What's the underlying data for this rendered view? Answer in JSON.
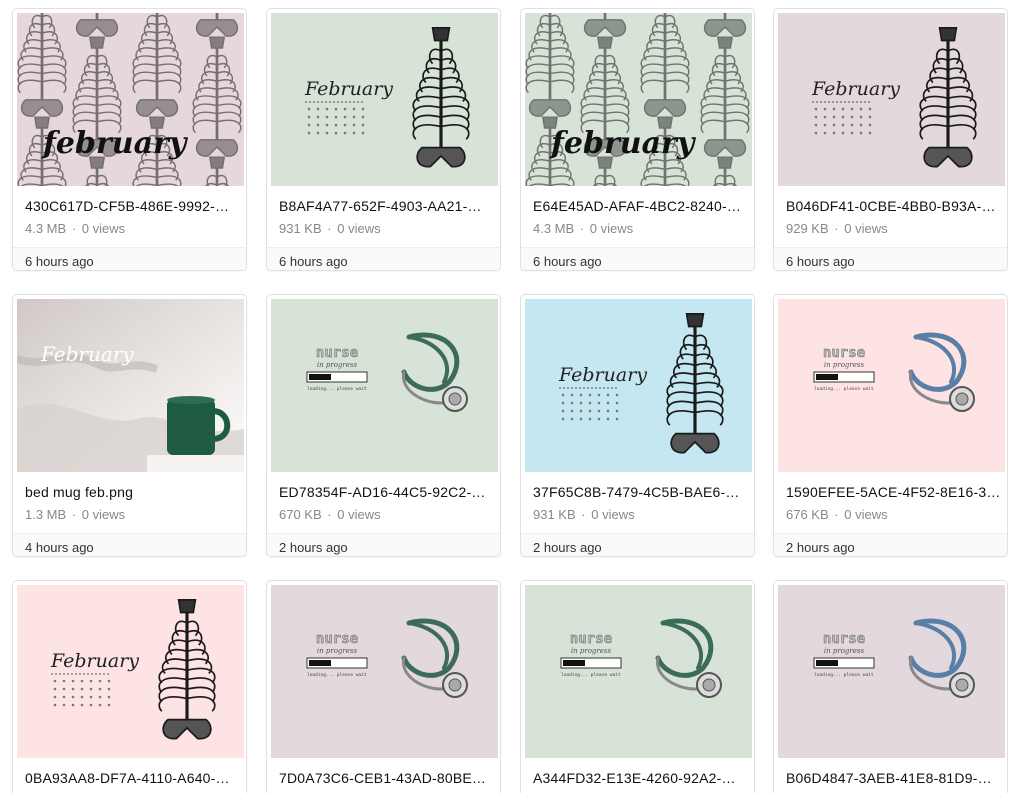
{
  "views_label": "views",
  "colors": {
    "pink": "#e6d7df",
    "green": "#d6e3d6",
    "mauve": "#e3d8de",
    "blue": "#c5e7f2",
    "rose": "#fde3e4"
  },
  "cards": [
    {
      "name": "430C617D-CF5B-486E-9992-…",
      "size": "4.3 MB",
      "views": "0",
      "time": "6 hours ago",
      "thumb": "skeleton-pattern",
      "thumb_text": "february"
    },
    {
      "name": "B8AF4A77-652F-4903-AA21-…",
      "size": "931 KB",
      "views": "0",
      "time": "6 hours ago",
      "thumb": "calendar-ribcage",
      "thumb_text": "February"
    },
    {
      "name": "E64E45AD-AFAF-4BC2-8240-…",
      "size": "4.3 MB",
      "views": "0",
      "time": "6 hours ago",
      "thumb": "skeleton-pattern",
      "thumb_text": "february"
    },
    {
      "name": "B046DF41-0CBE-4BB0-B93A-…",
      "size": "929 KB",
      "views": "0",
      "time": "6 hours ago",
      "thumb": "calendar-ribcage",
      "thumb_text": "February"
    },
    {
      "name": "bed mug feb.png",
      "size": "1.3 MB",
      "views": "0",
      "time": "4 hours ago",
      "thumb": "bed-mug-photo",
      "thumb_text": "February"
    },
    {
      "name": "ED78354F-AD16-44C5-92C2-…",
      "size": "670 KB",
      "views": "0",
      "time": "2 hours ago",
      "thumb": "nurse-stethoscope",
      "thumb_text": "nurse",
      "thumb_sub": "in progress",
      "thumb_note": "loading... please wait"
    },
    {
      "name": "37F65C8B-7479-4C5B-BAE6-…",
      "size": "931 KB",
      "views": "0",
      "time": "2 hours ago",
      "thumb": "calendar-ribcage",
      "thumb_text": "February"
    },
    {
      "name": "1590EFEE-5ACE-4F52-8E16-3…",
      "size": "676 KB",
      "views": "0",
      "time": "2 hours ago",
      "thumb": "nurse-stethoscope",
      "thumb_text": "nurse",
      "thumb_sub": "in progress",
      "thumb_note": "loading... please wait"
    },
    {
      "name": "0BA93AA8-DF7A-4110-A640-…",
      "thumb": "calendar-ribcage",
      "thumb_text": "February"
    },
    {
      "name": "7D0A73C6-CEB1-43AD-80BE…",
      "thumb": "nurse-stethoscope",
      "thumb_text": "nurse",
      "thumb_sub": "in progress",
      "thumb_note": "loading... please wait"
    },
    {
      "name": "A344FD32-E13E-4260-92A2-…",
      "thumb": "nurse-stethoscope",
      "thumb_text": "nurse",
      "thumb_sub": "in progress",
      "thumb_note": "loading... please wait"
    },
    {
      "name": "B06D4847-3AEB-41E8-81D9-…",
      "thumb": "nurse-stethoscope",
      "thumb_text": "nurse",
      "thumb_sub": "in progress",
      "thumb_note": "loading... please wait"
    }
  ]
}
